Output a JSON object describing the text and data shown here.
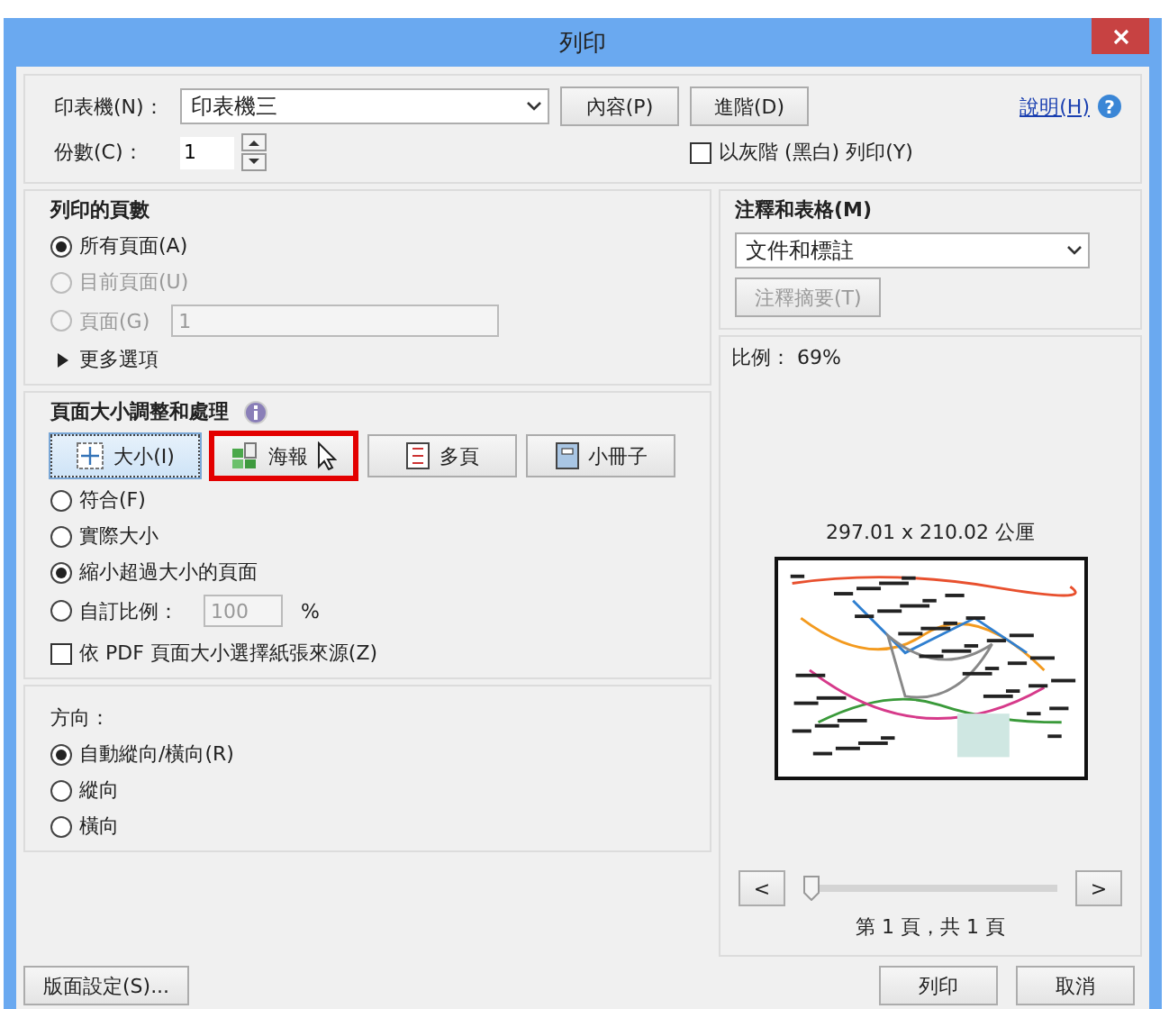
{
  "window": {
    "title": "列印"
  },
  "printer": {
    "label": "印表機(N)：",
    "value": "印表機三",
    "buttons": [
      "內容(P)",
      "進階(D)"
    ],
    "help": "說明(H)",
    "help_icon": "?"
  },
  "copies": {
    "label": "份數(C)：",
    "value": "1"
  },
  "grayscale": {
    "label": "以灰階 (黑白) 列印(Y)",
    "checked": false
  },
  "pages": {
    "title": "列印的頁數",
    "options": [
      {
        "label": "所有頁面(A)",
        "selected": true,
        "disabled": false
      },
      {
        "label": "目前頁面(U)",
        "selected": false,
        "disabled": true
      },
      {
        "label": "頁面(G)",
        "selected": false,
        "disabled": true,
        "field": "1"
      }
    ],
    "more": "更多選項"
  },
  "sizing": {
    "title": "頁面大小調整和處理",
    "modes": [
      {
        "label": "大小(I)",
        "selected": true,
        "highlighted": false
      },
      {
        "label": "海報",
        "selected": false,
        "highlighted": true
      },
      {
        "label": "多頁",
        "selected": false,
        "highlighted": false
      },
      {
        "label": "小冊子",
        "selected": false,
        "highlighted": false
      }
    ],
    "options": [
      {
        "label": "符合(F)",
        "selected": false
      },
      {
        "label": "實際大小",
        "selected": false
      },
      {
        "label": "縮小超過大小的頁面",
        "selected": true
      },
      {
        "label": "自訂比例：",
        "selected": false,
        "field": "100",
        "unit": "%"
      }
    ],
    "paper_source": {
      "label": "依 PDF 頁面大小選擇紙張來源(Z)",
      "checked": false
    }
  },
  "orientation": {
    "title": "方向：",
    "options": [
      {
        "label": "自動縱向/橫向(R)",
        "selected": true
      },
      {
        "label": "縱向",
        "selected": false
      },
      {
        "label": "橫向",
        "selected": false
      }
    ]
  },
  "comments": {
    "title": "注釋和表格(M)",
    "value": "文件和標註",
    "summary_button": {
      "label": "注釋摘要(T)",
      "disabled": true
    }
  },
  "preview": {
    "scale": "比例： 69%",
    "size": "297.01 x 210.02 公厘",
    "prev": "<",
    "next": ">",
    "slider": {
      "level": 0
    },
    "page": "第 1 頁，共 1 頁"
  },
  "page_setup": "版面設定(S)...",
  "footer_buttons": [
    "列印",
    "取消"
  ]
}
